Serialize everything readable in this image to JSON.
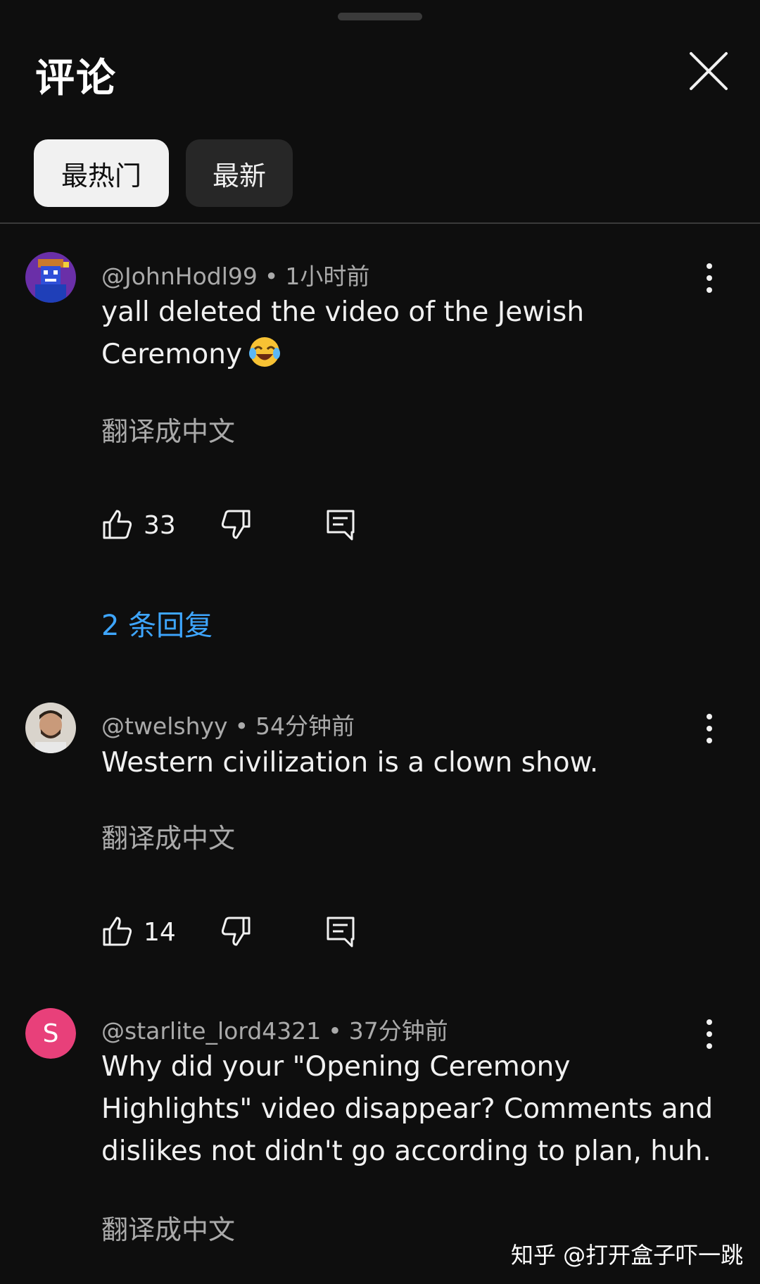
{
  "panel": {
    "title": "评论",
    "sort_chips": [
      "最热门",
      "最新"
    ]
  },
  "comments": [
    {
      "handle": "@JohnHodl99",
      "time": "1小时前",
      "text": "yall deleted the video of the Jewish Ceremony",
      "emoji": "face-with-tears-of-joy-icon",
      "translate": "翻译成中文",
      "likes": "33",
      "replies": "2 条回复",
      "avatar_icon": "pixel-art-avatar"
    },
    {
      "handle": "@twelshyy",
      "time": "54分钟前",
      "text": "Western civilization is a clown show.",
      "translate": "翻译成中文",
      "likes": "14",
      "avatar_icon": "profile-photo-avatar"
    },
    {
      "handle": "@starlite_lord4321",
      "time": "37分钟前",
      "text": "Why did your \"Opening Ceremony Highlights\" video disappear? Comments and dislikes not didn't go according to plan, huh.",
      "translate": "翻译成中文",
      "avatar_letter": "S",
      "avatar_color": "#e8407a"
    }
  ],
  "watermark": "知乎 @打开盒子吓一跳",
  "colors": {
    "background": "#0e0e0e",
    "link_blue": "#3ea6ff",
    "secondary_text": "#aaaaaa"
  }
}
